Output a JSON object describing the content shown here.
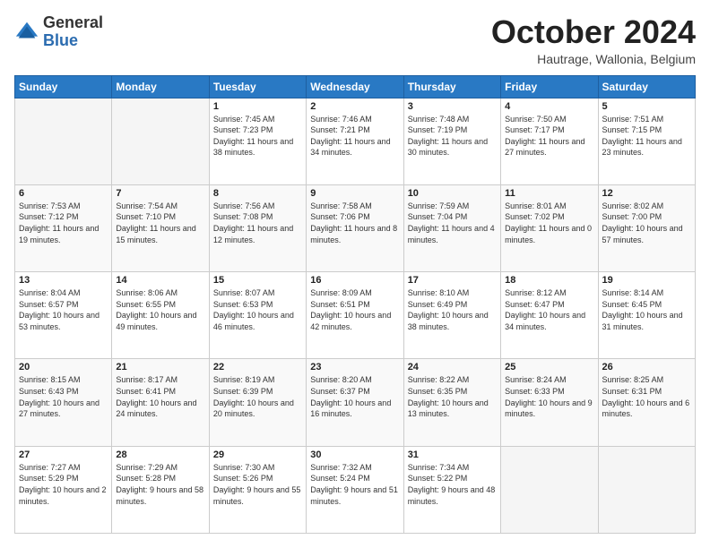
{
  "header": {
    "logo": {
      "line1": "General",
      "line2": "Blue"
    },
    "title": "October 2024",
    "subtitle": "Hautrage, Wallonia, Belgium"
  },
  "weekdays": [
    "Sunday",
    "Monday",
    "Tuesday",
    "Wednesday",
    "Thursday",
    "Friday",
    "Saturday"
  ],
  "weeks": [
    [
      {
        "day": "",
        "info": ""
      },
      {
        "day": "",
        "info": ""
      },
      {
        "day": "1",
        "info": "Sunrise: 7:45 AM\nSunset: 7:23 PM\nDaylight: 11 hours and 38 minutes."
      },
      {
        "day": "2",
        "info": "Sunrise: 7:46 AM\nSunset: 7:21 PM\nDaylight: 11 hours and 34 minutes."
      },
      {
        "day": "3",
        "info": "Sunrise: 7:48 AM\nSunset: 7:19 PM\nDaylight: 11 hours and 30 minutes."
      },
      {
        "day": "4",
        "info": "Sunrise: 7:50 AM\nSunset: 7:17 PM\nDaylight: 11 hours and 27 minutes."
      },
      {
        "day": "5",
        "info": "Sunrise: 7:51 AM\nSunset: 7:15 PM\nDaylight: 11 hours and 23 minutes."
      }
    ],
    [
      {
        "day": "6",
        "info": "Sunrise: 7:53 AM\nSunset: 7:12 PM\nDaylight: 11 hours and 19 minutes."
      },
      {
        "day": "7",
        "info": "Sunrise: 7:54 AM\nSunset: 7:10 PM\nDaylight: 11 hours and 15 minutes."
      },
      {
        "day": "8",
        "info": "Sunrise: 7:56 AM\nSunset: 7:08 PM\nDaylight: 11 hours and 12 minutes."
      },
      {
        "day": "9",
        "info": "Sunrise: 7:58 AM\nSunset: 7:06 PM\nDaylight: 11 hours and 8 minutes."
      },
      {
        "day": "10",
        "info": "Sunrise: 7:59 AM\nSunset: 7:04 PM\nDaylight: 11 hours and 4 minutes."
      },
      {
        "day": "11",
        "info": "Sunrise: 8:01 AM\nSunset: 7:02 PM\nDaylight: 11 hours and 0 minutes."
      },
      {
        "day": "12",
        "info": "Sunrise: 8:02 AM\nSunset: 7:00 PM\nDaylight: 10 hours and 57 minutes."
      }
    ],
    [
      {
        "day": "13",
        "info": "Sunrise: 8:04 AM\nSunset: 6:57 PM\nDaylight: 10 hours and 53 minutes."
      },
      {
        "day": "14",
        "info": "Sunrise: 8:06 AM\nSunset: 6:55 PM\nDaylight: 10 hours and 49 minutes."
      },
      {
        "day": "15",
        "info": "Sunrise: 8:07 AM\nSunset: 6:53 PM\nDaylight: 10 hours and 46 minutes."
      },
      {
        "day": "16",
        "info": "Sunrise: 8:09 AM\nSunset: 6:51 PM\nDaylight: 10 hours and 42 minutes."
      },
      {
        "day": "17",
        "info": "Sunrise: 8:10 AM\nSunset: 6:49 PM\nDaylight: 10 hours and 38 minutes."
      },
      {
        "day": "18",
        "info": "Sunrise: 8:12 AM\nSunset: 6:47 PM\nDaylight: 10 hours and 34 minutes."
      },
      {
        "day": "19",
        "info": "Sunrise: 8:14 AM\nSunset: 6:45 PM\nDaylight: 10 hours and 31 minutes."
      }
    ],
    [
      {
        "day": "20",
        "info": "Sunrise: 8:15 AM\nSunset: 6:43 PM\nDaylight: 10 hours and 27 minutes."
      },
      {
        "day": "21",
        "info": "Sunrise: 8:17 AM\nSunset: 6:41 PM\nDaylight: 10 hours and 24 minutes."
      },
      {
        "day": "22",
        "info": "Sunrise: 8:19 AM\nSunset: 6:39 PM\nDaylight: 10 hours and 20 minutes."
      },
      {
        "day": "23",
        "info": "Sunrise: 8:20 AM\nSunset: 6:37 PM\nDaylight: 10 hours and 16 minutes."
      },
      {
        "day": "24",
        "info": "Sunrise: 8:22 AM\nSunset: 6:35 PM\nDaylight: 10 hours and 13 minutes."
      },
      {
        "day": "25",
        "info": "Sunrise: 8:24 AM\nSunset: 6:33 PM\nDaylight: 10 hours and 9 minutes."
      },
      {
        "day": "26",
        "info": "Sunrise: 8:25 AM\nSunset: 6:31 PM\nDaylight: 10 hours and 6 minutes."
      }
    ],
    [
      {
        "day": "27",
        "info": "Sunrise: 7:27 AM\nSunset: 5:29 PM\nDaylight: 10 hours and 2 minutes."
      },
      {
        "day": "28",
        "info": "Sunrise: 7:29 AM\nSunset: 5:28 PM\nDaylight: 9 hours and 58 minutes."
      },
      {
        "day": "29",
        "info": "Sunrise: 7:30 AM\nSunset: 5:26 PM\nDaylight: 9 hours and 55 minutes."
      },
      {
        "day": "30",
        "info": "Sunrise: 7:32 AM\nSunset: 5:24 PM\nDaylight: 9 hours and 51 minutes."
      },
      {
        "day": "31",
        "info": "Sunrise: 7:34 AM\nSunset: 5:22 PM\nDaylight: 9 hours and 48 minutes."
      },
      {
        "day": "",
        "info": ""
      },
      {
        "day": "",
        "info": ""
      }
    ]
  ]
}
